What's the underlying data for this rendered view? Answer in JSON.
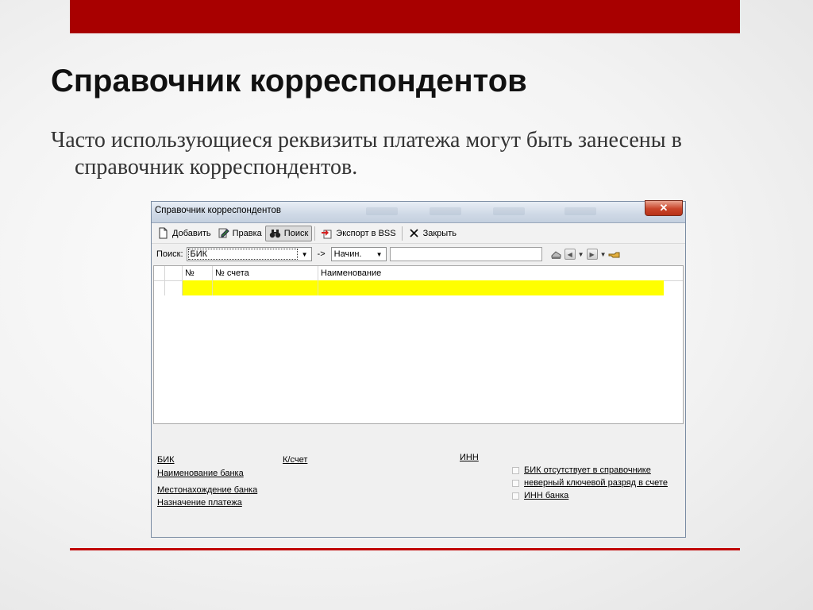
{
  "slide": {
    "title": "Справочник корреспондентов",
    "text": "Часто использующиеся реквизиты платежа могут быть занесены в справочник корреспондентов."
  },
  "window": {
    "title": "Справочник корреспондентов",
    "close_label": "✕",
    "toolbar": {
      "add": "Добавить",
      "edit": "Правка",
      "search": "Поиск",
      "export": "Экспорт в BSS",
      "close": "Закрыть"
    },
    "searchbar": {
      "label": "Поиск:",
      "field_value": "БИК",
      "arrow_text": "->",
      "mode_value": "Начин.",
      "query_value": ""
    },
    "grid": {
      "columns": [
        "№",
        "№ счета",
        "Наименование"
      ]
    },
    "info": {
      "bik": "БИК",
      "account": "К/счет",
      "inn": "ИНН",
      "bank_name": "Наименование банка",
      "bank_location": "Местонахождение банка",
      "purpose": "Назначение платежа",
      "checks": [
        "БИК отсутствует в справочнике",
        "неверный ключевой разряд в счете",
        "ИНН банка"
      ]
    }
  },
  "colors": {
    "accent_bar": "#a80000",
    "bottom_line": "#c00000",
    "selected_row": "#ffff00"
  }
}
